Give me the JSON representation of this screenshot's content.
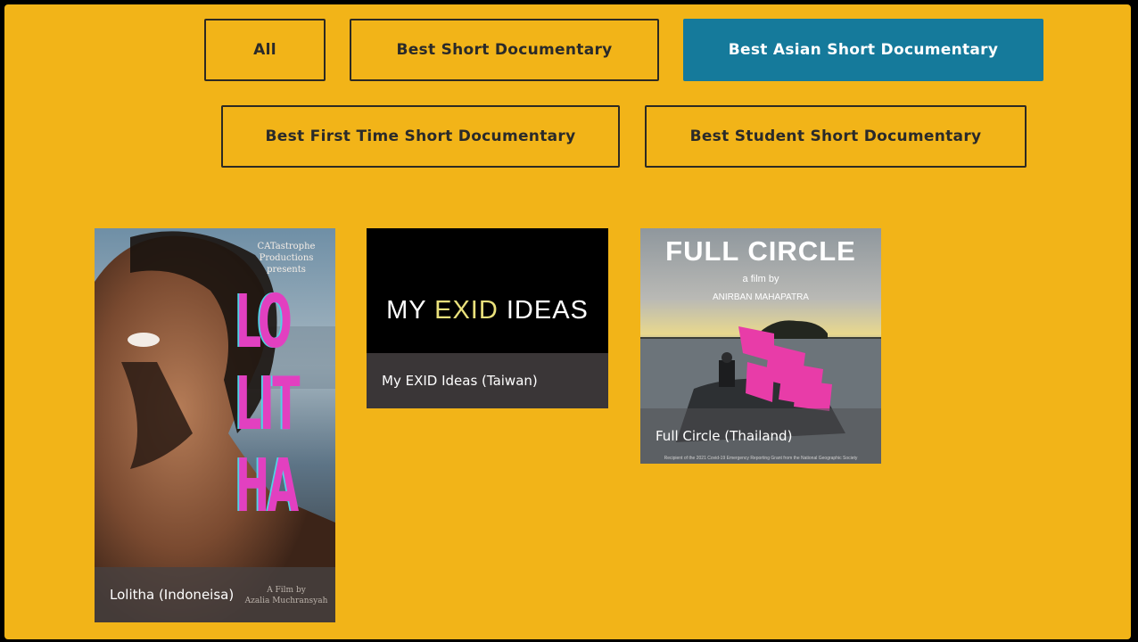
{
  "filters": [
    {
      "label": "All",
      "active": false
    },
    {
      "label": "Best Short Documentary",
      "active": false
    },
    {
      "label": "Best Asian Short Documentary",
      "active": true
    },
    {
      "label": "Best First Time Short Documentary",
      "active": false
    },
    {
      "label": "Best Student Short Documentary",
      "active": false
    }
  ],
  "colors": {
    "background": "#f2b418",
    "active_filter": "#157a9b",
    "button_border": "#2d2a22",
    "caption_overlay": "#464141"
  },
  "films": [
    {
      "caption": "Lolitha (Indoneisa)",
      "poster": {
        "presenter_line1": "CATastrophe",
        "presenter_line2": "Productions",
        "presenter_line3": "presents",
        "title_line1": "LO",
        "title_line2": "LIT",
        "title_line3": "HA",
        "credit_line1": "A Film by",
        "credit_line2": "Azalia Muchransyah"
      }
    },
    {
      "caption": "My EXID Ideas (Taiwan)",
      "poster": {
        "title_part1": "MY ",
        "title_part2": "EXID",
        "title_part3": " IDEAS"
      }
    },
    {
      "caption": "Full Circle (Thailand)",
      "poster": {
        "title": "FULL CIRCLE",
        "subtitle": "a film by",
        "director": "ANIRBAN MAHAPATRA",
        "footer": "Recipient of the 2021 Covid-19 Emergency Reporting Grant from the National Geographic Society"
      }
    }
  ]
}
